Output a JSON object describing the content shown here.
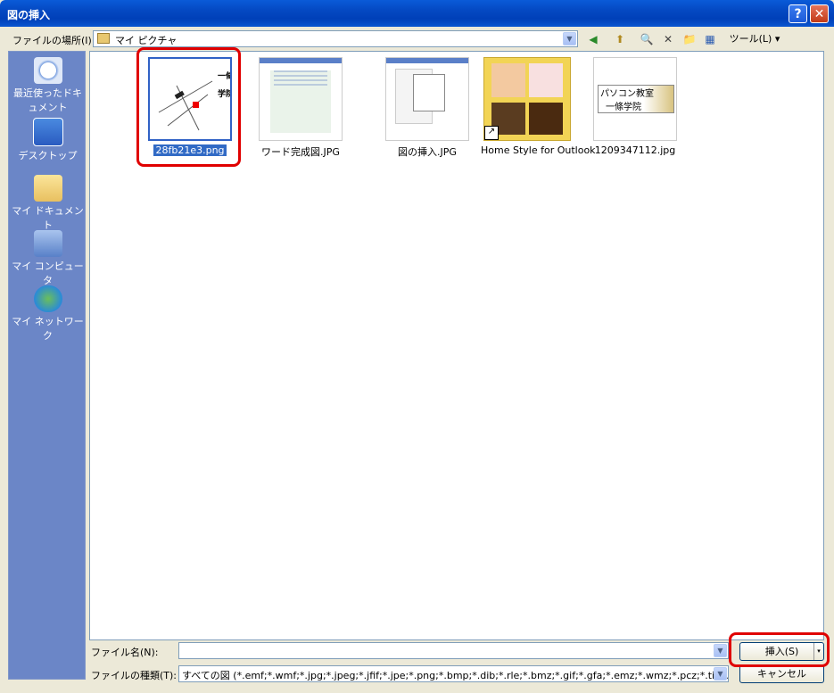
{
  "window": {
    "title": "図の挿入",
    "help_icon": "?",
    "close_icon": "✕"
  },
  "toolbar": {
    "lookin_label": "ファイルの場所(I):",
    "lookin_value": "マイ ピクチャ",
    "back_icon": "◀",
    "up_icon": "⬆",
    "search_icon": "🔍",
    "delete_icon": "✕",
    "newfolder_icon": "📁",
    "views_icon": "▦",
    "tools_label": "ツール(L) ▾"
  },
  "places": [
    {
      "label": "最近使ったドキュメント",
      "icon": "recent-documents-icon"
    },
    {
      "label": "デスクトップ",
      "icon": "desktop-icon"
    },
    {
      "label": "マイ ドキュメント",
      "icon": "my-documents-icon"
    },
    {
      "label": "マイ コンピュータ",
      "icon": "my-computer-icon"
    },
    {
      "label": "マイ ネットワーク",
      "icon": "my-network-icon"
    }
  ],
  "files": [
    {
      "name": "28fb21e3.png",
      "selected": true
    },
    {
      "name": "ワード完成図.JPG",
      "selected": false
    },
    {
      "name": "図の挿入.JPG",
      "selected": false
    },
    {
      "name": "Home Style for Outlook",
      "selected": false
    },
    {
      "name": "1209347112.jpg",
      "selected": false
    }
  ],
  "thumb_text": {
    "ikkyo1": "一條",
    "ikkyo2": "学院",
    "pc1": "パソコン教室",
    "pc2": "一條学院"
  },
  "bottom": {
    "filename_label": "ファイル名(N):",
    "filename_value": "",
    "filetype_label": "ファイルの種類(T):",
    "filetype_value": "すべての図 (*.emf;*.wmf;*.jpg;*.jpeg;*.jfif;*.jpe;*.png;*.bmp;*.dib;*.rle;*.bmz;*.gif;*.gfa;*.emz;*.wmz;*.pcz;*.tif;*.tiff;*.pcd;*.pc",
    "insert_label": "挿入(S)",
    "cancel_label": "キャンセル"
  },
  "colors": {
    "highlight": "#e00000",
    "selection": "#316ac5",
    "places_bg": "#6b86c7"
  }
}
